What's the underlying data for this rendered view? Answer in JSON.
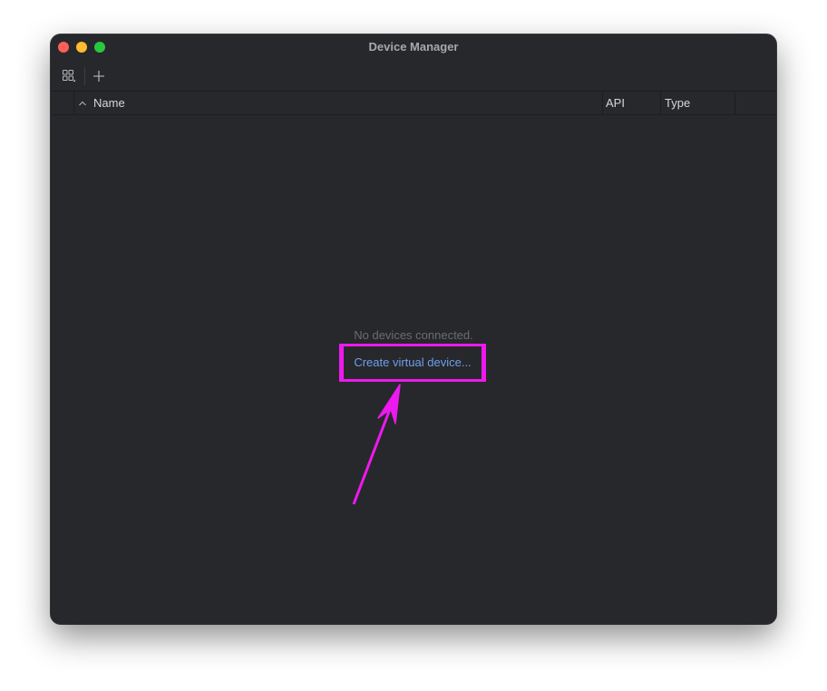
{
  "window": {
    "title": "Device Manager"
  },
  "table": {
    "columns": [
      {
        "label": "Name"
      },
      {
        "label": "API"
      },
      {
        "label": "Type"
      }
    ]
  },
  "empty_state": {
    "message": "No devices connected.",
    "action_label": "Create virtual device..."
  },
  "colors": {
    "window_bg": "#27282b",
    "link": "#6d9ff0",
    "annotation": "#ee19ee"
  },
  "icons": {
    "toolbar_left": "device-group-icon",
    "toolbar_add": "plus-icon",
    "sort": "chevron-up-icon"
  }
}
